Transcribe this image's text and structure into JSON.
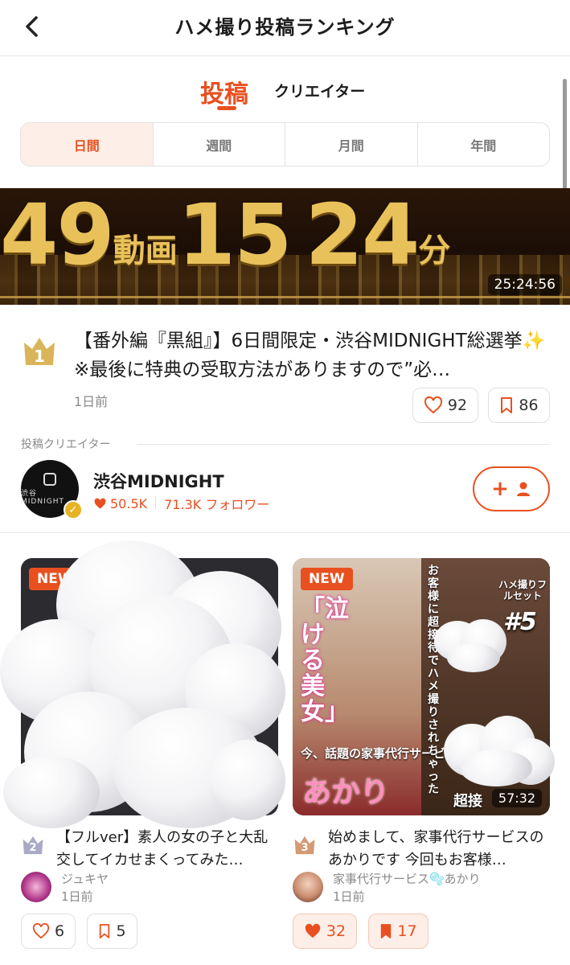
{
  "header": {
    "title": "ハメ撮り投稿ランキング",
    "back_icon": "chevron-left-icon"
  },
  "tabs": {
    "posts": "投稿",
    "creators": "クリエイター",
    "active": "posts"
  },
  "period": {
    "items": [
      "日間",
      "週間",
      "月間",
      "年間"
    ],
    "active": "日間"
  },
  "featured": {
    "banner_text": [
      "49",
      "動画",
      "15",
      "24",
      "分"
    ],
    "duration": "25:24:56",
    "rank": "1",
    "title": "【番外編『黒組』】6日間限定・渋谷MIDNIGHT総選挙✨　※最後に特典の受取方法がありますので”必…",
    "time": "1日前",
    "likes": "92",
    "bookmarks": "86"
  },
  "creator_section": {
    "label": "投稿クリエイター",
    "avatar_text": "渋谷MIDNIGHT",
    "name": "渋谷MIDNIGHT",
    "likes": "50.5K",
    "followers": "71.3K フォロワー",
    "follow_icon": "+ user-icon"
  },
  "cards": [
    {
      "badge": "NEW",
      "rank": "2",
      "title": "【フルver】素人の女の子と大乱交してイカせまくってみた…",
      "creator": "ジュキヤ",
      "time": "1日前",
      "likes": "6",
      "bookmarks": "5",
      "liked": false,
      "bookmarked": false
    },
    {
      "badge": "NEW",
      "duration": "57:32",
      "rank": "3",
      "thumb_texts": [
        "「泣ける美女」",
        "今、話題の家事代行サービス",
        "あかり",
        "お客様に超接待でハメ撮りされちゃった",
        "ハメ撮りフルセット",
        "#5",
        "超接"
      ],
      "title": "始めまして、家事代行サービスのあかりです 今回もお客様…",
      "creator": "家事代行サービス🫧あかり",
      "time": "1日前",
      "likes": "32",
      "bookmarks": "17",
      "liked": true,
      "bookmarked": true
    }
  ],
  "colors": {
    "accent": "#e8501f",
    "accent_light": "#fdeee8",
    "crown_gold": "#d9b45a",
    "crown_silver": "#a9abc6",
    "crown_bronze": "#d49a76"
  }
}
